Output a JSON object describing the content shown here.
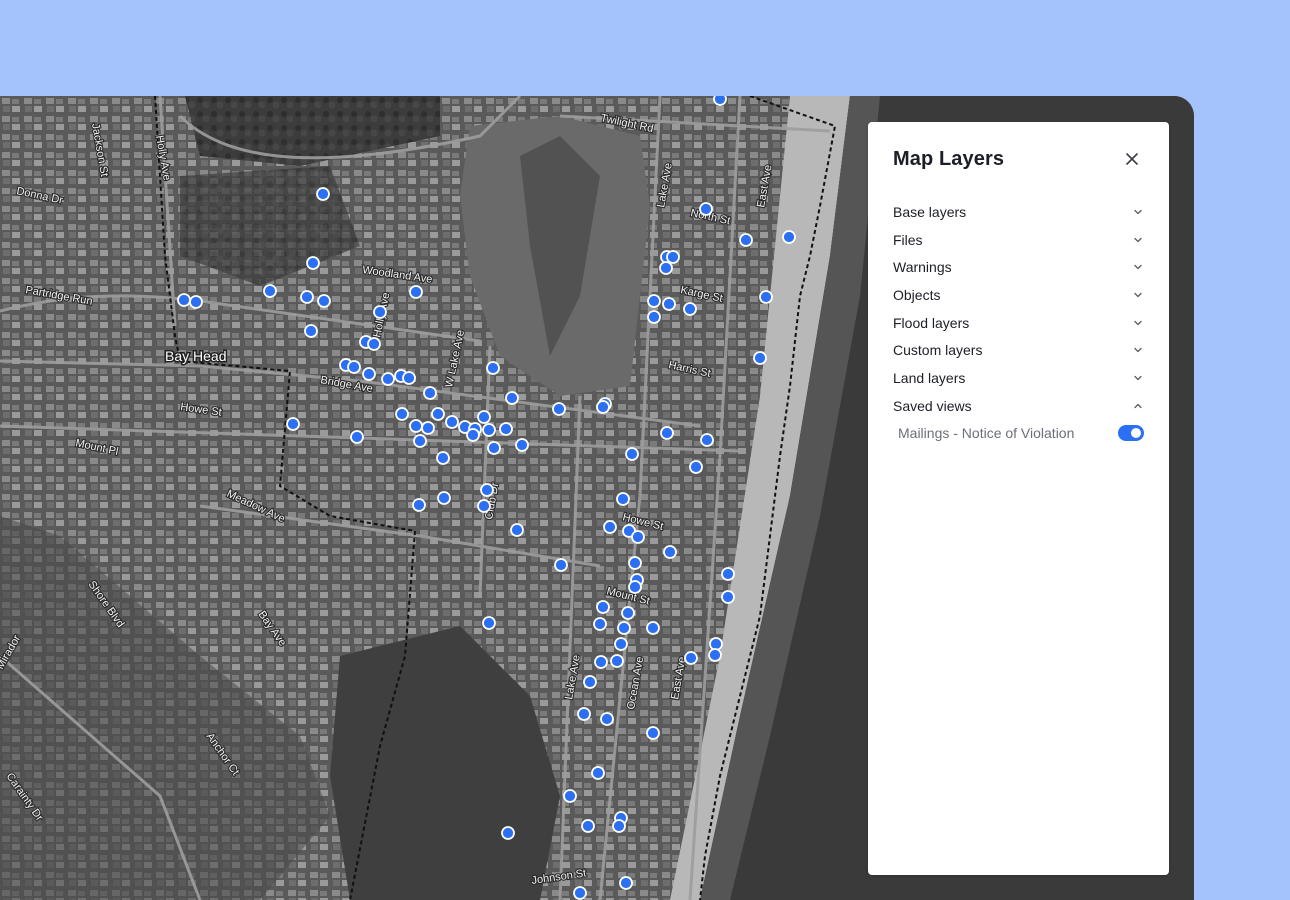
{
  "colors": {
    "page_background": "#a4c3fd",
    "accent": "#2b6ff2",
    "map_frame": "#4d4d50",
    "panel_background": "#ffffff"
  },
  "map": {
    "town_label": "Bay Head",
    "streets": [
      "Jackson St",
      "Holly Ave",
      "Donna Dr",
      "Woodland Ave",
      "Partridge Run",
      "Holly Ave",
      "W Lake Ave",
      "Bridge Ave",
      "Howe St",
      "Mount Pl",
      "Meadow Ave",
      "Club Dr",
      "Shore Blvd",
      "Bay Ave",
      "Mirador",
      "Anchor Ct",
      "Carainty Dr",
      "Twilight Rd",
      "Lake Ave",
      "North St",
      "East Ave",
      "Karge St",
      "Harris St",
      "Howe St",
      "Mount St",
      "Lake Ave",
      "Ocean Ave",
      "East Ave",
      "Johnson St"
    ],
    "marker_icon": "location-dot-icon"
  },
  "panel": {
    "title": "Map Layers",
    "close_icon": "close-icon",
    "layers": [
      {
        "label": "Base layers",
        "state": "collapsed"
      },
      {
        "label": "Files",
        "state": "collapsed"
      },
      {
        "label": "Warnings",
        "state": "collapsed"
      },
      {
        "label": "Objects",
        "state": "collapsed"
      },
      {
        "label": "Flood layers",
        "state": "collapsed"
      },
      {
        "label": "Custom layers",
        "state": "collapsed"
      },
      {
        "label": "Land layers",
        "state": "collapsed"
      },
      {
        "label": "Saved views",
        "state": "expanded"
      }
    ],
    "saved_views": [
      {
        "label": "Mailings - Notice of Violation",
        "enabled": true
      }
    ]
  }
}
